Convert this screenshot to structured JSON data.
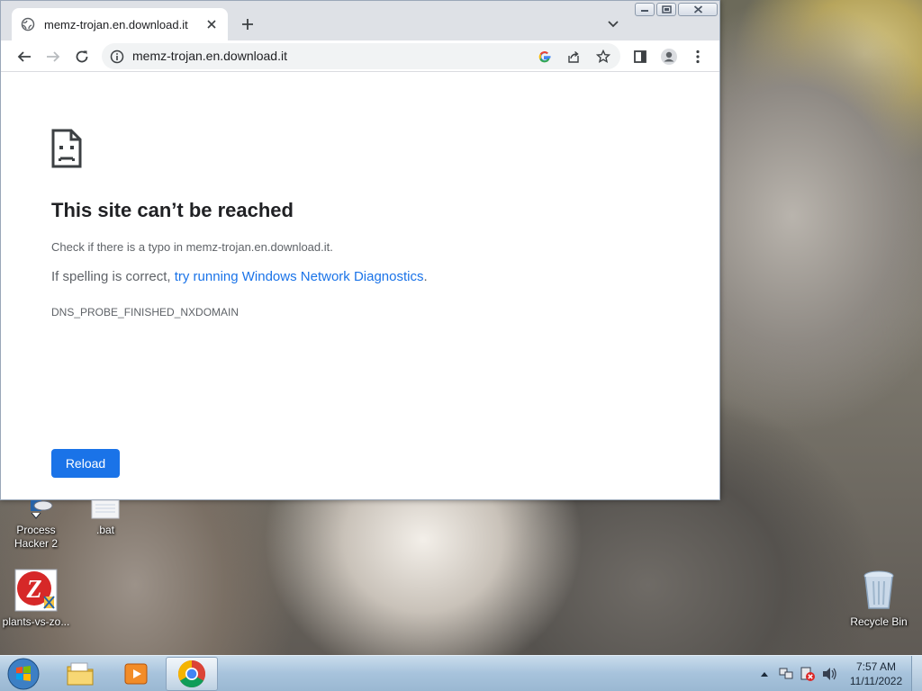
{
  "browser": {
    "tab": {
      "title": "memz-trojan.en.download.it",
      "favicon": "globe-icon",
      "close_glyph": "✕"
    },
    "new_tab_glyph": "+",
    "tab_search_icon": "chevron-down-icon",
    "window_controls": [
      "minimize-icon",
      "restore-icon",
      "close-icon"
    ],
    "toolbar": {
      "back_icon": "arrow-left-icon",
      "forward_icon": "arrow-right-icon",
      "reload_icon": "reload-icon",
      "url": "memz-trojan.en.download.it",
      "site_info_icon": "info-icon",
      "google_icon": "google-icon",
      "share_icon": "share-icon",
      "bookmark_icon": "star-icon",
      "side_panel_icon": "side-panel-icon",
      "profile_icon": "profile-icon",
      "menu_icon": "kebab-menu-icon"
    }
  },
  "error_page": {
    "icon": "sad-page-icon",
    "title": "This site can’t be reached",
    "line1": "Check if there is a typo in memz-trojan.en.download.it.",
    "line2_prefix": "If spelling is correct, ",
    "line2_link": "try running Windows Network Diagnostics",
    "line2_suffix": ".",
    "error_code": "DNS_PROBE_FINISHED_NXDOMAIN",
    "reload_label": "Reload"
  },
  "desktop": {
    "icons": [
      {
        "label_line1": "Process",
        "label_line2": "Hacker 2",
        "icon": "process-hacker-icon"
      },
      {
        "label_line1": ".bat",
        "label_line2": "",
        "icon": "batch-file-icon"
      },
      {
        "label_line1": "plants-vs-zo...",
        "label_line2": "",
        "icon": "plants-vs-zombies-icon"
      },
      {
        "label_line1": "Recycle Bin",
        "label_line2": "",
        "icon": "recycle-bin-icon"
      }
    ]
  },
  "taskbar": {
    "start_icon": "windows-start-icon",
    "pinned": [
      "file-explorer-icon",
      "media-player-icon",
      "chrome-icon"
    ],
    "active": "chrome-icon",
    "tray_icons": [
      "show-hidden-icons-icon",
      "network-icon",
      "action-center-icon",
      "volume-icon"
    ],
    "clock_time": "7:57 AM",
    "clock_date": "11/11/2022"
  },
  "colors": {
    "link_blue": "#1a73e8",
    "button_blue": "#1a73e8",
    "tabstrip": "#dee1e6",
    "text_primary": "#202124",
    "text_secondary": "#5f6368"
  }
}
